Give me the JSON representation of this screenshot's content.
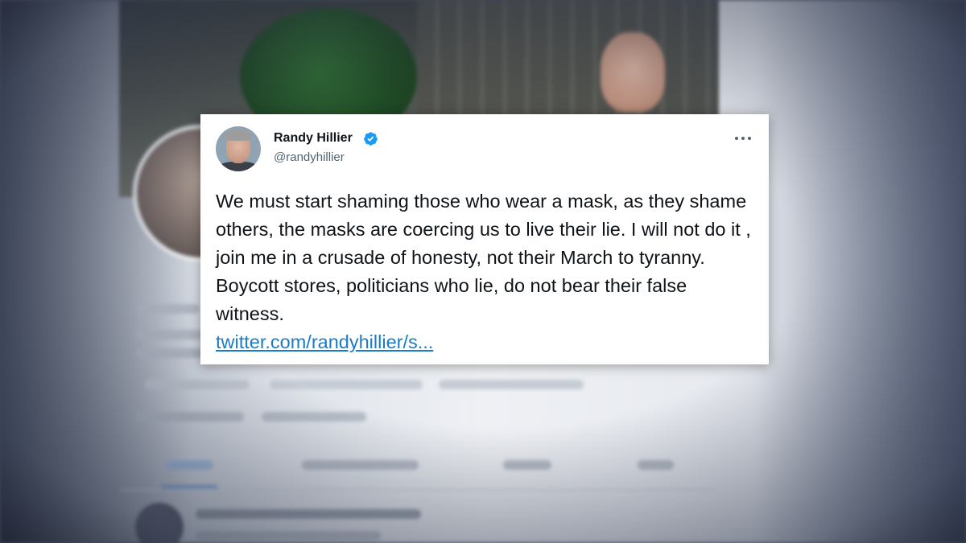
{
  "colors": {
    "link": "#1b7bc7",
    "verified": "#1d9bf0",
    "text": "#0f1419",
    "muted": "#536471",
    "card_bg": "#ffffff"
  },
  "tweet": {
    "display_name": "Randy Hillier",
    "handle": "@randyhillier",
    "verified": true,
    "verified_icon": "verified-badge-icon",
    "more_icon": "more-options-icon",
    "text": "We must start shaming those who wear a mask, as they shame others,  the masks are coercing us to live their lie. I will not do it , join me in a crusade of honesty, not their March to tyranny. Boycott stores, politicians who lie, do not bear their false witness.",
    "link_text": "twitter.com/randyhillier/s..."
  }
}
